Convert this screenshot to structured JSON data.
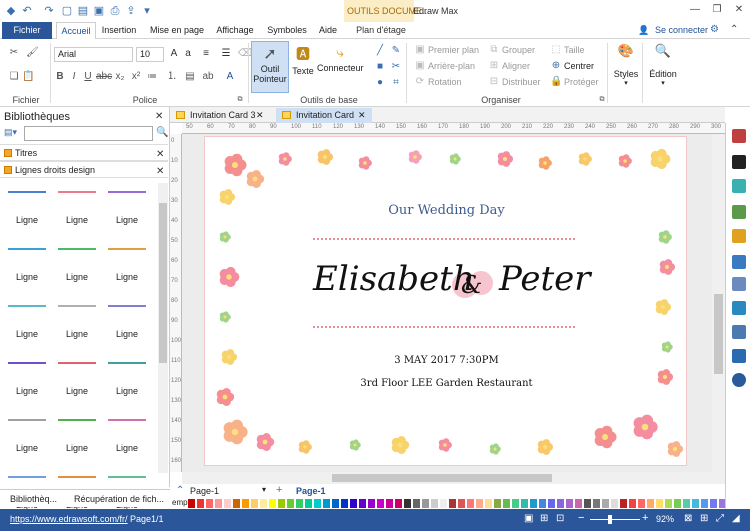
{
  "titlebar": {
    "contextual_tab": "OUTILS DOCUME...",
    "app_title": "Edraw Max"
  },
  "tabs": {
    "file": "Fichier",
    "items": [
      "Accueil",
      "Insertion",
      "Mise en page",
      "Affichage",
      "Symboles",
      "Aide",
      "Plan d'étage"
    ],
    "connect": "Se connecter"
  },
  "ribbon": {
    "groups": {
      "file": "Fichier",
      "font": "Police",
      "tools": "Outils de base",
      "arrange": "Organiser"
    },
    "font_name": "Arial",
    "font_size": "10",
    "tool_pointer": "Outil",
    "tool_pointer2": "Pointeur",
    "tool_text": "Texte",
    "tool_connector": "Connecteur",
    "arrange": {
      "front": "Premier plan",
      "back": "Arrière-plan",
      "rotate": "Rotation",
      "group": "Grouper",
      "align": "Aligner",
      "distribute": "Distribuer",
      "size": "Taille",
      "center": "Centrer",
      "protect": "Protéger"
    },
    "styles": "Styles",
    "edit": "Édition"
  },
  "library": {
    "title": "Bibliothèques",
    "sections": [
      "Titres",
      "Lignes droits design"
    ],
    "line_label": "Ligne",
    "line_colors": [
      "#4a7fd0",
      "#e87a8c",
      "#9a6ad0",
      "#3aa0d8",
      "#4cb86a",
      "#e0a040",
      "#5ab8c8",
      "#b0b0b0",
      "#8080d0",
      "#7050d0",
      "#e06070",
      "#40a0a0",
      "#a0a0a0",
      "#50b050",
      "#d070b0",
      "#70a0e0",
      "#e09040",
      "#60c090"
    ]
  },
  "left_tabs": [
    "Bibliothèq...",
    "Récupération de fich..."
  ],
  "doc_tabs": [
    "Invitation Card 3",
    "Invitation Card"
  ],
  "card": {
    "subtitle": "Our Wedding Day",
    "names_left": "Elisabeth",
    "amp": "&",
    "names_right": "Peter",
    "date": "3 MAY 2017  7:30PM",
    "venue": "3rd Floor LEE Garden Restaurant"
  },
  "pages": {
    "tab1": "Page-1",
    "tab2": "Page-1"
  },
  "palette_label": "emp",
  "status": {
    "url": "https://www.edrawsoft.com/fr/",
    "page": "Page1/1",
    "zoom": "92%"
  },
  "ruler_top": [
    "50",
    "60",
    "70",
    "80",
    "90",
    "100",
    "110",
    "120",
    "130",
    "140",
    "150",
    "160",
    "170",
    "180",
    "190",
    "200",
    "210",
    "220",
    "230",
    "240",
    "250",
    "260",
    "270",
    "280",
    "290",
    "300"
  ],
  "ruler_left": [
    "0",
    "10",
    "20",
    "30",
    "40",
    "50",
    "60",
    "70",
    "80",
    "90",
    "100",
    "110",
    "120",
    "130",
    "140",
    "150",
    "160"
  ]
}
